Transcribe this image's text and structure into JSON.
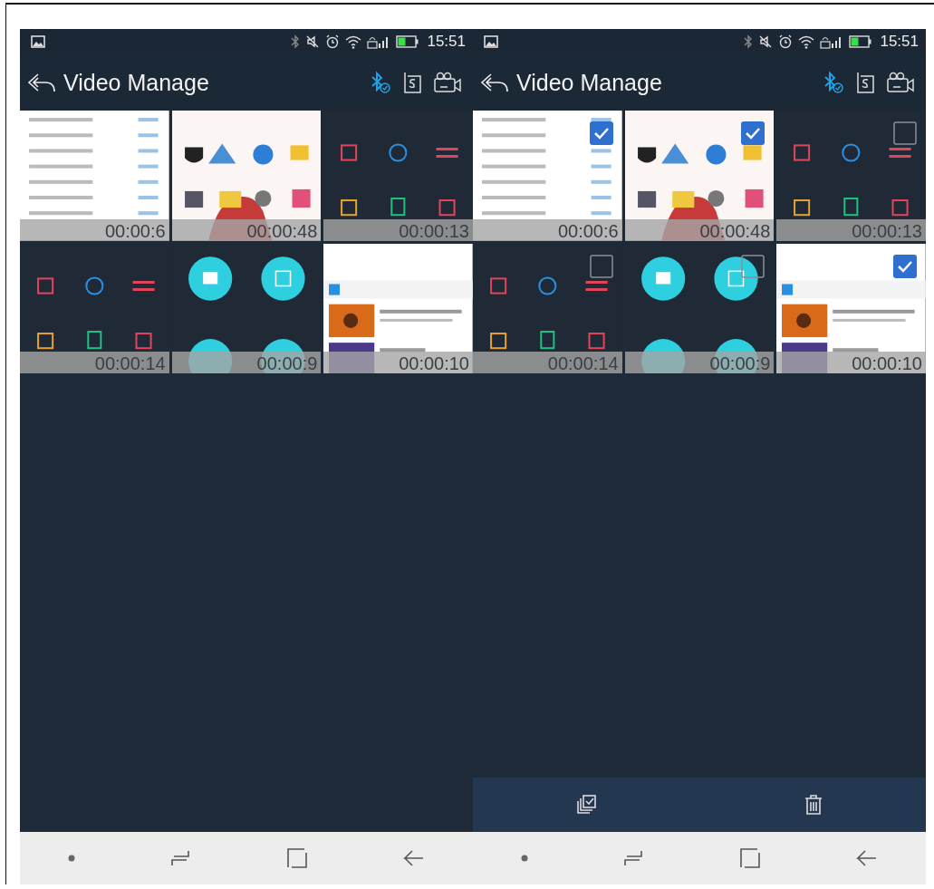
{
  "phones": [
    {
      "status_bar": {
        "time": "15:51"
      },
      "title": "Video Manage",
      "selection_mode": false,
      "videos": [
        {
          "duration": "00:00:6"
        },
        {
          "duration": "00:00:48"
        },
        {
          "duration": "00:00:13"
        },
        {
          "duration": "00:00:14"
        },
        {
          "duration": "00:00:9"
        },
        {
          "duration": "00:00:10"
        }
      ]
    },
    {
      "status_bar": {
        "time": "15:51"
      },
      "title": "Video Manage",
      "selection_mode": true,
      "videos": [
        {
          "duration": "00:00:6",
          "checked": true
        },
        {
          "duration": "00:00:48",
          "checked": true
        },
        {
          "duration": "00:00:13",
          "checked": false
        },
        {
          "duration": "00:00:14",
          "checked": false
        },
        {
          "duration": "00:00:9",
          "checked": false
        },
        {
          "duration": "00:00:10",
          "checked": true
        }
      ]
    }
  ]
}
